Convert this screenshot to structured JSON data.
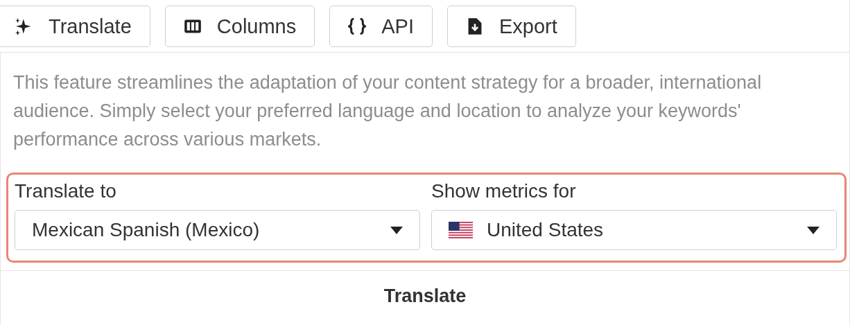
{
  "toolbar": [
    {
      "kind": "sparkle",
      "label": "Translate"
    },
    {
      "kind": "columns",
      "label": "Columns"
    },
    {
      "kind": "braces",
      "label": "API"
    },
    {
      "kind": "export",
      "label": "Export"
    }
  ],
  "description": "This feature streamlines the adaptation of your content strategy for a broader, international audience. Simply select your preferred language and location to analyze your keywords' performance across various markets.",
  "fields": [
    {
      "label": "Translate to",
      "value": "Mexican Spanish (Mexico)",
      "flag": false
    },
    {
      "label": "Show metrics for",
      "value": "United States",
      "flag": true
    }
  ],
  "submit": "Translate"
}
